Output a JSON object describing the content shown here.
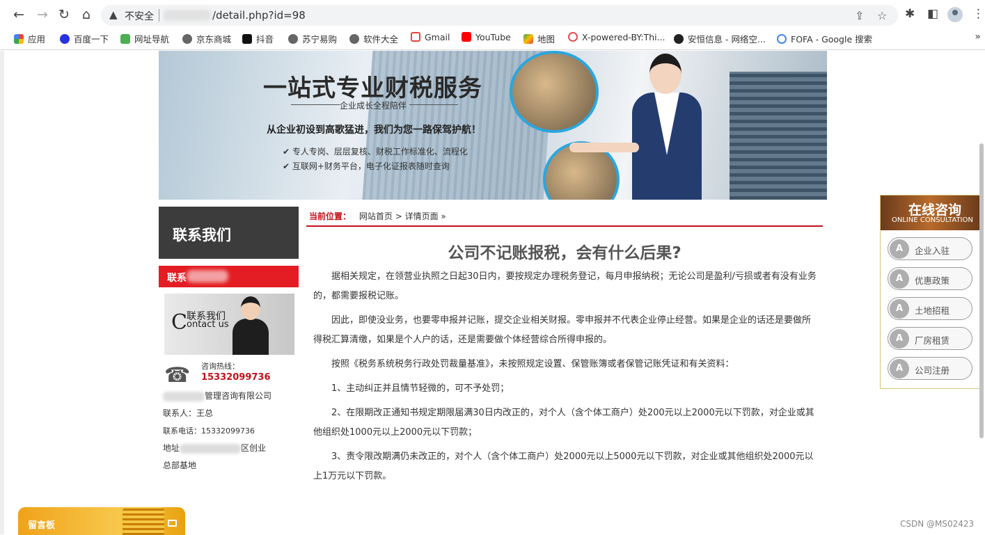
{
  "browser": {
    "insecure_label": "不安全",
    "url_visible": "/detail.php?id=98",
    "bookmarks": [
      "应用",
      "百度一下",
      "网址导航",
      "京东商城",
      "抖音",
      "苏宁易购",
      "软件大全",
      "Gmail",
      "YouTube",
      "地图",
      "X-powered-BY:Thi...",
      "安恒信息 - 网络空...",
      "FOFA - Google 搜索"
    ],
    "bookmarks_more": "»"
  },
  "banner": {
    "title": "一站式专业财税服务",
    "subtitle": "企业成长全程陪伴",
    "slogan": "从企业初设到高歌猛进，我们为您一路保驾护航！",
    "check1": "专人专岗、层层复核、财税工作标准化、流程化",
    "check2": "互联网+财务平台，电子化证报表随时查询"
  },
  "sidebar": {
    "heading": "联系我们",
    "red_label": "联系",
    "img_text_cn": "联系我们",
    "img_text_c": "C",
    "img_text_en": "ontact us",
    "hotline_label": "咨询热线：",
    "hotline_number": "15332099736",
    "company_suffix": "管理咨询有限公司",
    "contact_person": "联系人：王总",
    "contact_phone": "联系电话：15332099736",
    "address_prefix": "地址",
    "address_suffix": "区创业",
    "address_line2": "总部基地"
  },
  "breadcrumb": {
    "label": "当前位置：",
    "home": "网站首页",
    "sep1": ">",
    "current": "详情页面",
    "sep2": "»"
  },
  "article": {
    "title": "公司不记账报税，会有什么后果?",
    "paragraphs": [
      "据相关规定，在领营业执照之日起30日内，要按规定办理税务登记，每月申报纳税；无论公司是盈利/亏损或者有没有业务的，都需要报税记账。",
      "因此，即使没业务，也要零申报并记账，提交企业相关财报。零申报并不代表企业停止经营。如果是企业的话还是要做所得税汇算清缴，如果是个人户的话，还是需要做个体经营综合所得申报的。",
      "按照《税务系统税务行政处罚裁量基准》，未按照规定设置、保管账簿或者保管记账凭证和有关资料：",
      "1、主动纠正并且情节轻微的，可不予处罚；",
      "2、在限期改正通知书规定期限届满30日内改正的，对个人（含个体工商户）处200元以上2000元以下罚款，对企业或其他组织处1000元以上2000元以下罚款；",
      "3、责令限改期满仍未改正的，对个人（含个体工商户）处2000元以上5000元以下罚款，对企业或其他组织处2000元以上1万元以下罚款。"
    ]
  },
  "consult": {
    "title": "在线咨询",
    "subtitle": "ONLINE CONSULTATION",
    "buttons": [
      "企业入驻",
      "优惠政策",
      "土地招租",
      "厂房租赁",
      "公司注册"
    ]
  },
  "message_board": {
    "label": "留言板"
  },
  "watermark": "CSDN @MS02423"
}
